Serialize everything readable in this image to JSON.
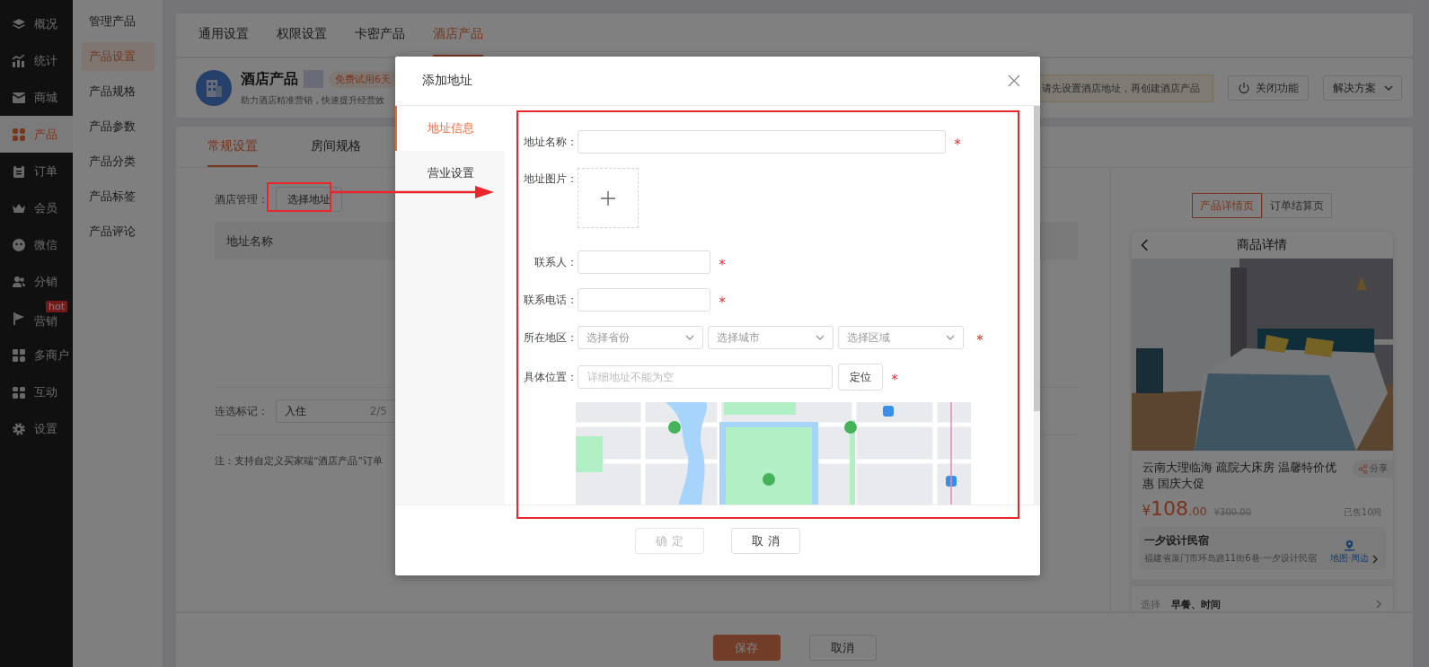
{
  "main_nav": [
    {
      "label": "概况",
      "selected": false
    },
    {
      "label": "统计",
      "selected": false
    },
    {
      "label": "商城",
      "selected": false
    },
    {
      "label": "产品",
      "selected": true
    },
    {
      "label": "订单",
      "selected": false
    },
    {
      "label": "会员",
      "selected": false
    },
    {
      "label": "微信",
      "selected": false
    },
    {
      "label": "分销",
      "selected": false
    },
    {
      "label": "营销",
      "selected": false,
      "badge": "hot"
    },
    {
      "label": "多商户",
      "selected": false
    },
    {
      "label": "互动",
      "selected": false
    },
    {
      "label": "设置",
      "selected": false
    }
  ],
  "sub_nav": [
    {
      "label": "管理产品",
      "selected": false
    },
    {
      "label": "产品设置",
      "selected": true
    },
    {
      "label": "产品规格",
      "selected": false
    },
    {
      "label": "产品参数",
      "selected": false
    },
    {
      "label": "产品分类",
      "selected": false
    },
    {
      "label": "产品标签",
      "selected": false
    },
    {
      "label": "产品评论",
      "selected": false
    }
  ],
  "top_tabs": [
    {
      "label": "通用设置",
      "selected": false
    },
    {
      "label": "权限设置",
      "selected": false
    },
    {
      "label": "卡密产品",
      "selected": false
    },
    {
      "label": "酒店产品",
      "selected": true
    }
  ],
  "product_header": {
    "title": "酒店产品",
    "badge": "免费试用6天",
    "description": "助力酒店精准营销，快速提升经营效",
    "notice": "请先设置酒店地址，再创建酒店产品",
    "close_button": "关闭功能",
    "solutions_button": "解决方案"
  },
  "settings": {
    "tabs": [
      {
        "label": "常规设置",
        "selected": true
      },
      {
        "label": "房间规格",
        "selected": false
      }
    ],
    "hotel_label": "酒店管理：",
    "select_button": "选择地址",
    "table_columns": [
      "地址名称"
    ],
    "mark_label": "连选标记：",
    "mark_value": "入住",
    "mark_count": "2/5",
    "note": "注：支持自定义买家端“酒店产品”订单"
  },
  "preview": {
    "tabs": [
      {
        "label": "产品详情页",
        "selected": true
      },
      {
        "label": "订单结算页",
        "selected": false
      }
    ],
    "title": "商品详情",
    "product_name": "云南大理临海 疏院大床房 温馨特价优惠 国庆大促",
    "share": "分享",
    "price": {
      "currency": "¥",
      "amount": "108",
      "decimals": ".00"
    },
    "original_price": "¥300.00",
    "sold": "已售10间",
    "shop_name": "一夕设计民宿",
    "shop_address": "福建省厦门市环岛路11街6巷·一夕设计民宿",
    "map_link": "地图·周边",
    "option_label": "选择",
    "option_value": "早餐、时间"
  },
  "footer_buttons": [
    {
      "label": "保存",
      "disabled": true
    },
    {
      "label": "取消",
      "disabled": false
    }
  ],
  "dialog": {
    "title": "添加地址",
    "menu": [
      {
        "label": "地址信息",
        "selected": true
      },
      {
        "label": "营业设置",
        "selected": false
      }
    ],
    "fields": [
      {
        "kind": "text",
        "label": "地址名称：",
        "required": true
      },
      {
        "kind": "upload",
        "label": "地址图片：",
        "required": false
      },
      {
        "kind": "short_text",
        "label": "联系人：",
        "required": true
      },
      {
        "kind": "short_text",
        "label": "联系电话：",
        "required": true
      },
      {
        "kind": "selects",
        "label": "所在地区：",
        "required": true,
        "placeholders": [
          "选择省份",
          "选择城市",
          "选择区域"
        ]
      },
      {
        "kind": "location",
        "label": "具体位置：",
        "required": true,
        "placeholder": "详细地址不能为空",
        "button": "定位"
      },
      {
        "kind": "map"
      }
    ],
    "buttons": [
      {
        "label": "确 定",
        "disabled": true
      },
      {
        "label": "取 消",
        "disabled": false
      }
    ]
  }
}
